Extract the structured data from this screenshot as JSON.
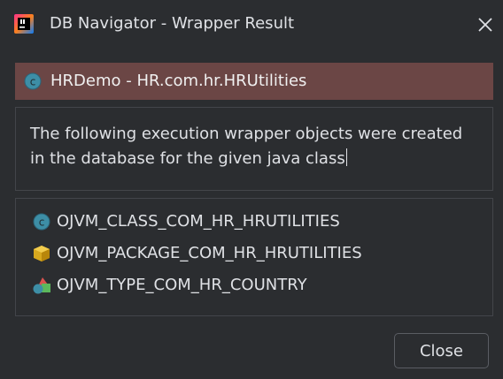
{
  "window": {
    "title": "DB Navigator - Wrapper Result",
    "app_icon": "jetbrains-logo-icon",
    "close_icon": "close-icon"
  },
  "header": {
    "icon": "java-class-icon",
    "text": "HRDemo - HR.com.hr.HRUtilities"
  },
  "message": {
    "text": "The following execution wrapper objects were created in the database for the given java class"
  },
  "objects": [
    {
      "icon": "java-class-icon",
      "label": "OJVM_CLASS_COM_HR_HRUTILITIES"
    },
    {
      "icon": "package-icon",
      "label": "OJVM_PACKAGE_COM_HR_HRUTILITIES"
    },
    {
      "icon": "object-type-icon",
      "label": "OJVM_TYPE_COM_HR_COUNTRY"
    }
  ],
  "footer": {
    "close_label": "Close"
  },
  "colors": {
    "background": "#2b2d30",
    "header_bar": "#6b4645",
    "text": "#dfe1e5",
    "border": "#43454a",
    "class_icon": "#3d8ea6"
  }
}
